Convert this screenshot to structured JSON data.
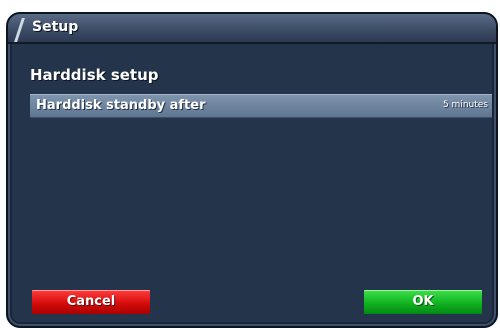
{
  "window": {
    "title": "Setup"
  },
  "section": {
    "title": "Harddisk setup"
  },
  "settings": [
    {
      "label": "Harddisk standby after",
      "value": "5 minutes"
    }
  ],
  "buttons": {
    "cancel_label": "Cancel",
    "ok_label": "OK"
  },
  "colors": {
    "window_background": "#24344a",
    "selected_row": "#6f86a0",
    "cancel_button": "#d60b0b",
    "ok_button": "#10b321"
  }
}
